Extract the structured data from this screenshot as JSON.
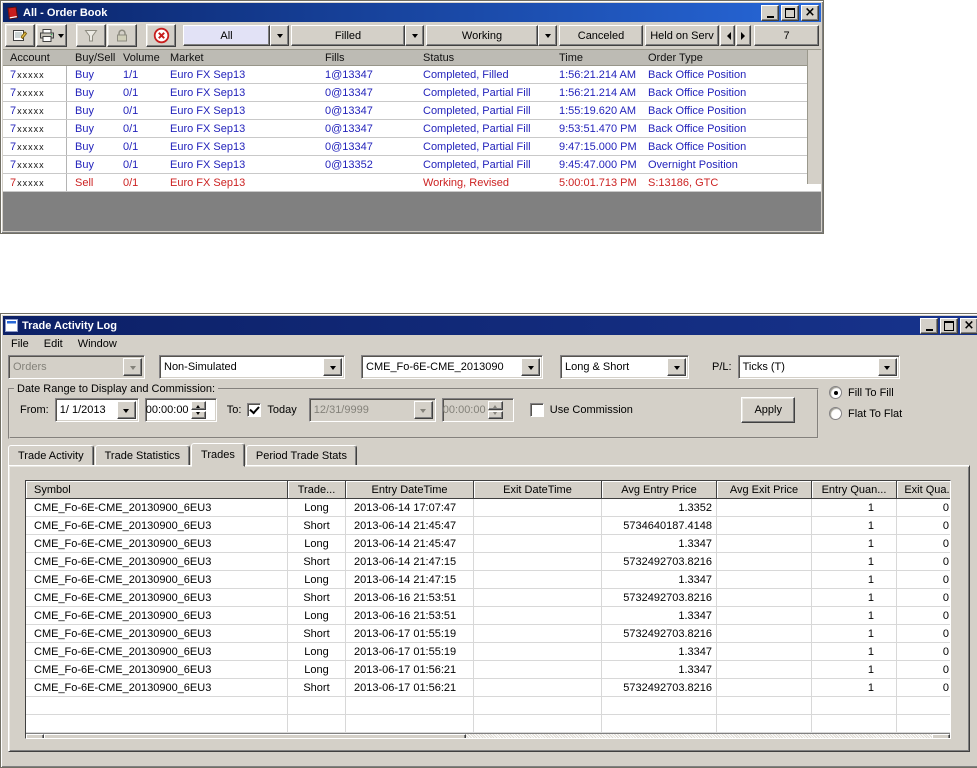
{
  "colors": {
    "title_gradient_start": "#0a246a",
    "title_gradient_end": "#2767d8",
    "buy_text": "#2323bb",
    "sell_text": "#cc2222",
    "selected_filter_tab_bg": "#e2e2f6",
    "window_chrome": "#d4d0c8"
  },
  "icons": {
    "book_icon": "red book (window icon)",
    "properties_icon": "form with pencil",
    "print_icon": "printer with dropdown",
    "filter_icon": "funnel (disabled)",
    "lock_icon": "padlock (disabled)",
    "cancel_icon": "red circle with X",
    "dropdown_arrow": "black down triangle",
    "scroll_arrows": "left/right triangles"
  },
  "order_book": {
    "title": "All - Order Book",
    "filter_tabs": {
      "all": "All",
      "filled": "Filled",
      "working": "Working",
      "canceled": "Canceled",
      "held": "Held on Serv",
      "count": "7"
    },
    "columns": [
      "Account",
      "Buy/Sell",
      "Volume",
      "Market",
      "Fills",
      "Status",
      "Time",
      "Order Type"
    ],
    "rows": [
      {
        "acct": "7",
        "mask": "xxxxx",
        "side": "Buy",
        "volume": "1/1",
        "market": "Euro FX Sep13",
        "fills": "1@13347",
        "status": "Completed, Filled",
        "time": "1:56:21.214 AM",
        "order_type": "Back Office Position",
        "tone": "blue"
      },
      {
        "acct": "7",
        "mask": "xxxxx",
        "side": "Buy",
        "volume": "0/1",
        "market": "Euro FX Sep13",
        "fills": "0@13347",
        "status": "Completed, Partial Fill",
        "time": "1:56:21.214 AM",
        "order_type": "Back Office Position",
        "tone": "blue"
      },
      {
        "acct": "7",
        "mask": "xxxxx",
        "side": "Buy",
        "volume": "0/1",
        "market": "Euro FX Sep13",
        "fills": "0@13347",
        "status": "Completed, Partial Fill",
        "time": "1:55:19.620 AM",
        "order_type": "Back Office Position",
        "tone": "blue"
      },
      {
        "acct": "7",
        "mask": "xxxxx",
        "side": "Buy",
        "volume": "0/1",
        "market": "Euro FX Sep13",
        "fills": "0@13347",
        "status": "Completed, Partial Fill",
        "time": "9:53:51.470 PM",
        "order_type": "Back Office Position",
        "tone": "blue"
      },
      {
        "acct": "7",
        "mask": "xxxxx",
        "side": "Buy",
        "volume": "0/1",
        "market": "Euro FX Sep13",
        "fills": "0@13347",
        "status": "Completed, Partial Fill",
        "time": "9:47:15.000 PM",
        "order_type": "Back Office Position",
        "tone": "blue"
      },
      {
        "acct": "7",
        "mask": "xxxxx",
        "side": "Buy",
        "volume": "0/1",
        "market": "Euro FX Sep13",
        "fills": "0@13352",
        "status": "Completed, Partial Fill",
        "time": "9:45:47.000 PM",
        "order_type": "Overnight Position",
        "tone": "blue"
      },
      {
        "acct": "7",
        "mask": "xxxxx",
        "side": "Sell",
        "volume": "0/1",
        "market": "Euro FX Sep13",
        "fills": "",
        "status": "Working, Revised",
        "time": "5:00:01.713 PM",
        "order_type": "S:13186, GTC",
        "tone": "red"
      }
    ]
  },
  "trade_log": {
    "title": "Trade Activity Log",
    "menu": [
      "File",
      "Edit",
      "Window"
    ],
    "filters": {
      "orders": "Orders",
      "simulated": "Non-Simulated",
      "instrument": "CME_Fo-6E-CME_2013090",
      "direction": "Long & Short",
      "pl_label": "P/L:",
      "pl_value": "Ticks (T)"
    },
    "date_range": {
      "legend": "Date Range to Display and Commission:",
      "from_label": "From:",
      "from_date": "1/ 1/2013",
      "from_time": "00:00:00",
      "to_label": "To:",
      "today_label": "Today",
      "to_date": "12/31/9999",
      "to_time": "00:00:00",
      "use_commission_label": "Use Commission",
      "apply_label": "Apply",
      "radio_fill_to_fill": "Fill To Fill",
      "radio_flat_to_flat": "Flat To Flat"
    },
    "tabs": [
      "Trade Activity",
      "Trade Statistics",
      "Trades",
      "Period Trade Stats"
    ],
    "active_tab": "Trades",
    "columns": [
      "Symbol",
      "Trade...",
      "Entry DateTime",
      "Exit DateTime",
      "Avg Entry Price",
      "Avg Exit Price",
      "Entry Quan...",
      "Exit Qua..."
    ],
    "rows": [
      {
        "symbol": "CME_Fo-6E-CME_20130900_6EU3",
        "trade": "Long",
        "entry_dt": "2013-06-14 17:07:47",
        "exit_dt": "",
        "avg_entry": "1.3352",
        "avg_exit": "",
        "entry_qty": "1",
        "exit_qty": "0"
      },
      {
        "symbol": "CME_Fo-6E-CME_20130900_6EU3",
        "trade": "Short",
        "entry_dt": "2013-06-14 21:45:47",
        "exit_dt": "",
        "avg_entry": "5734640187.4148",
        "avg_exit": "",
        "entry_qty": "1",
        "exit_qty": "0"
      },
      {
        "symbol": "CME_Fo-6E-CME_20130900_6EU3",
        "trade": "Long",
        "entry_dt": "2013-06-14 21:45:47",
        "exit_dt": "",
        "avg_entry": "1.3347",
        "avg_exit": "",
        "entry_qty": "1",
        "exit_qty": "0"
      },
      {
        "symbol": "CME_Fo-6E-CME_20130900_6EU3",
        "trade": "Short",
        "entry_dt": "2013-06-14 21:47:15",
        "exit_dt": "",
        "avg_entry": "5732492703.8216",
        "avg_exit": "",
        "entry_qty": "1",
        "exit_qty": "0"
      },
      {
        "symbol": "CME_Fo-6E-CME_20130900_6EU3",
        "trade": "Long",
        "entry_dt": "2013-06-14 21:47:15",
        "exit_dt": "",
        "avg_entry": "1.3347",
        "avg_exit": "",
        "entry_qty": "1",
        "exit_qty": "0"
      },
      {
        "symbol": "CME_Fo-6E-CME_20130900_6EU3",
        "trade": "Short",
        "entry_dt": "2013-06-16 21:53:51",
        "exit_dt": "",
        "avg_entry": "5732492703.8216",
        "avg_exit": "",
        "entry_qty": "1",
        "exit_qty": "0"
      },
      {
        "symbol": "CME_Fo-6E-CME_20130900_6EU3",
        "trade": "Long",
        "entry_dt": "2013-06-16 21:53:51",
        "exit_dt": "",
        "avg_entry": "1.3347",
        "avg_exit": "",
        "entry_qty": "1",
        "exit_qty": "0"
      },
      {
        "symbol": "CME_Fo-6E-CME_20130900_6EU3",
        "trade": "Short",
        "entry_dt": "2013-06-17 01:55:19",
        "exit_dt": "",
        "avg_entry": "5732492703.8216",
        "avg_exit": "",
        "entry_qty": "1",
        "exit_qty": "0"
      },
      {
        "symbol": "CME_Fo-6E-CME_20130900_6EU3",
        "trade": "Long",
        "entry_dt": "2013-06-17 01:55:19",
        "exit_dt": "",
        "avg_entry": "1.3347",
        "avg_exit": "",
        "entry_qty": "1",
        "exit_qty": "0"
      },
      {
        "symbol": "CME_Fo-6E-CME_20130900_6EU3",
        "trade": "Long",
        "entry_dt": "2013-06-17 01:56:21",
        "exit_dt": "",
        "avg_entry": "1.3347",
        "avg_exit": "",
        "entry_qty": "1",
        "exit_qty": "0"
      },
      {
        "symbol": "CME_Fo-6E-CME_20130900_6EU3",
        "trade": "Short",
        "entry_dt": "2013-06-17 01:56:21",
        "exit_dt": "",
        "avg_entry": "5732492703.8216",
        "avg_exit": "",
        "entry_qty": "1",
        "exit_qty": "0"
      }
    ]
  }
}
